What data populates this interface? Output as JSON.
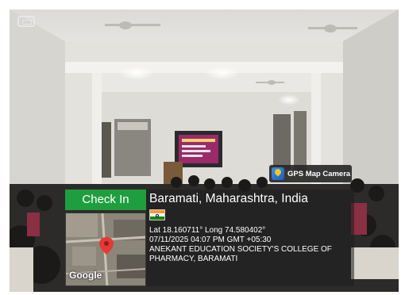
{
  "badge": {
    "label": "GPS Map Camera"
  },
  "checkin": {
    "label": "Check In"
  },
  "location": {
    "title": "Baramati, Maharashtra, India",
    "coords": "Lat 18.160711° Long 74.580402°",
    "datetime": "07/11/2025 04:07 PM GMT +05:30",
    "address_line1": "ANEKANT EDUCATION SOCIETY'S COLLEGE OF",
    "address_line2": "PHARMACY, BARAMATI"
  },
  "map": {
    "provider": "Google"
  }
}
